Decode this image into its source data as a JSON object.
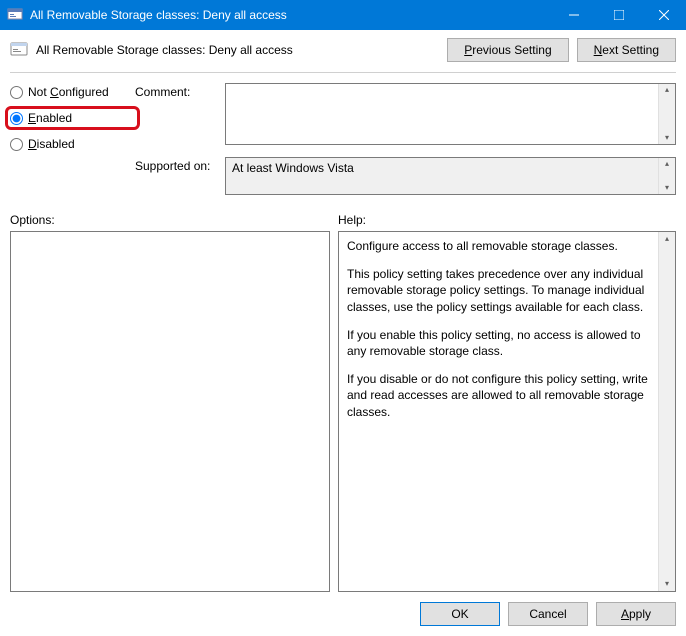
{
  "window": {
    "title": "All Removable Storage classes: Deny all access"
  },
  "header": {
    "title": "All Removable Storage classes: Deny all access",
    "prev_btn_u": "P",
    "prev_btn_rest": "revious Setting",
    "next_btn_u": "N",
    "next_btn_rest": "ext Setting"
  },
  "radios": {
    "not_configured_u": "C",
    "not_configured_rest": "onfigured",
    "not_configured_prefix": "Not ",
    "enabled_u": "E",
    "enabled_rest": "nabled",
    "disabled_u": "D",
    "disabled_rest": "isabled"
  },
  "fields": {
    "comment_label": "Comment:",
    "comment_value": "",
    "supported_label": "Supported on:",
    "supported_value": "At least Windows Vista"
  },
  "panels": {
    "options_label": "Options:",
    "help_label": "Help:",
    "help_p1": "Configure access to all removable storage classes.",
    "help_p2": "This policy setting takes precedence over any individual removable storage policy settings. To manage individual classes, use the policy settings available for each class.",
    "help_p3": "If you enable this policy setting, no access is allowed to any removable storage class.",
    "help_p4": "If you disable or do not configure this policy setting, write and read accesses are allowed to all removable storage classes."
  },
  "footer": {
    "ok": "OK",
    "cancel": "Cancel",
    "apply_u": "A",
    "apply_rest": "pply"
  }
}
